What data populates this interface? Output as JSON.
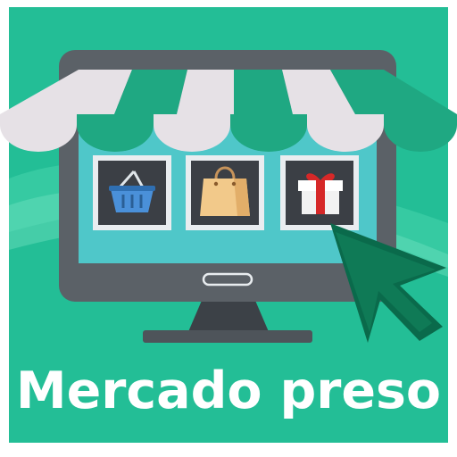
{
  "app": {
    "title": "Mercado preso"
  },
  "icons": {
    "storefront": "storefront-monitor-icon",
    "basket": "basket-icon",
    "shopping_bag": "shopping-bag-icon",
    "gift": "gift-box-icon",
    "cursor": "cursor-arrow-icon"
  },
  "colors": {
    "background": "#23BE96",
    "awning_green": "#1FA882",
    "awning_white": "#E6E1E6",
    "monitor_frame": "#5B6167",
    "screen": "#4FC7C9",
    "cursor": "#0A6A4B",
    "title": "#FFFFFF"
  }
}
